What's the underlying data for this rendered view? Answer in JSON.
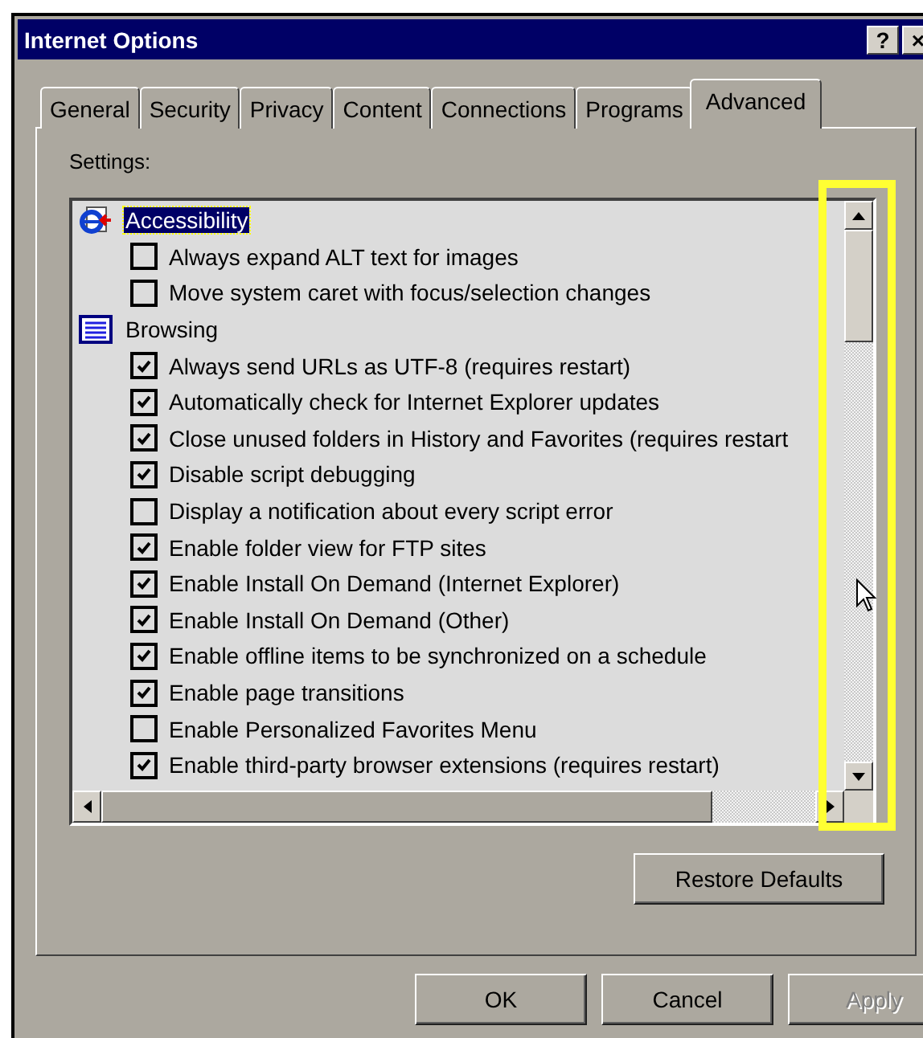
{
  "window": {
    "title": "Internet Options",
    "title_buttons": [
      "?",
      "×"
    ]
  },
  "tabs": [
    {
      "label": "General",
      "selected": false
    },
    {
      "label": "Security",
      "selected": false
    },
    {
      "label": "Privacy",
      "selected": false
    },
    {
      "label": "Content",
      "selected": false
    },
    {
      "label": "Connections",
      "selected": false
    },
    {
      "label": "Programs",
      "selected": false
    },
    {
      "label": "Advanced",
      "selected": true
    }
  ],
  "settings_label": "Settings:",
  "settings": [
    {
      "label": "Accessibility",
      "selected": true,
      "children": [
        {
          "label": "Always expand ALT text for images",
          "checked": false
        },
        {
          "label": "Move system caret with focus/selection changes",
          "checked": false
        }
      ]
    },
    {
      "label": "Browsing",
      "selected": false,
      "children": [
        {
          "label": "Always send URLs as UTF-8 (requires restart)",
          "checked": true
        },
        {
          "label": "Automatically check for Internet Explorer updates",
          "checked": true
        },
        {
          "label": "Close unused folders in History and Favorites (requires restart",
          "checked": true
        },
        {
          "label": "Disable script debugging",
          "checked": true
        },
        {
          "label": "Display a notification about every script error",
          "checked": false
        },
        {
          "label": "Enable folder view for FTP sites",
          "checked": true
        },
        {
          "label": "Enable Install On Demand (Internet Explorer)",
          "checked": true
        },
        {
          "label": "Enable Install On Demand (Other)",
          "checked": true
        },
        {
          "label": "Enable offline items to be synchronized on a schedule",
          "checked": true
        },
        {
          "label": "Enable page transitions",
          "checked": true
        },
        {
          "label": "Enable Personalized Favorites Menu",
          "checked": false
        },
        {
          "label": "Enable third-party browser extensions (requires restart)",
          "checked": true
        }
      ]
    }
  ],
  "restore_button": "Restore Defaults",
  "buttons": [
    {
      "label": "OK",
      "disabled": false
    },
    {
      "label": "Cancel",
      "disabled": false
    },
    {
      "label": "Apply",
      "disabled": true
    }
  ]
}
